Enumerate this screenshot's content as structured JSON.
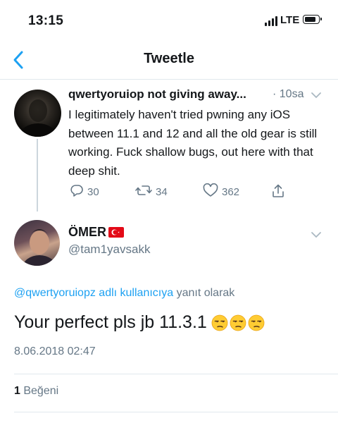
{
  "status_bar": {
    "time": "13:15",
    "network": "LTE"
  },
  "nav": {
    "title": "Tweetle"
  },
  "parent_tweet": {
    "author": "qwertyoruiop not giving away...",
    "age": "· 10sa",
    "text": "I legitimately haven't tried pwning any iOS between 11.1 and 12 and all the old gear is still working. Fuck shallow bugs, out here with that deep shit.",
    "replies": "30",
    "retweets": "34",
    "likes": "362"
  },
  "tweet": {
    "author": "ÖMER",
    "handle": "@tam1yavsakk",
    "reply_context_link": "@qwertyoruiopz adlı kullanıcıya",
    "reply_context_suffix": "yanıt olarak",
    "text": "Your perfect pls jb 11.3.1",
    "emoji_count": 3,
    "date": "8.06.2018 02:47",
    "like_count": "1",
    "like_label": "Beğeni"
  },
  "colors": {
    "accent": "#1da1f2",
    "muted": "#657786",
    "text": "#14171a",
    "divider": "#e1e8ed",
    "flag": "#e30a17"
  },
  "icons": [
    "back-chevron-icon",
    "signal-icon",
    "battery-icon",
    "reply-icon",
    "retweet-icon",
    "heart-icon",
    "share-icon",
    "chevron-down-icon",
    "turkey-flag-icon",
    "unamused-face-icon"
  ]
}
